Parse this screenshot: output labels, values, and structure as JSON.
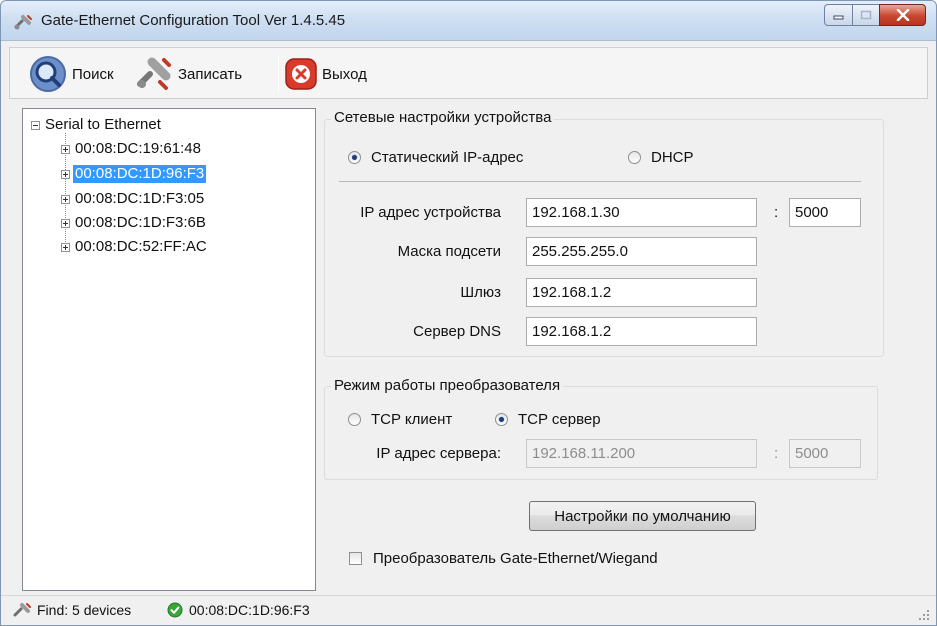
{
  "window": {
    "title": "Gate-Ethernet Configuration Tool Ver 1.4.5.45"
  },
  "toolbar": {
    "search_label": "Поиск",
    "write_label": "Записать",
    "exit_label": "Выход"
  },
  "tree": {
    "root_label": "Serial to Ethernet",
    "devices": [
      {
        "mac": "00:08:DC:19:61:48",
        "selected": false
      },
      {
        "mac": "00:08:DC:1D:96:F3",
        "selected": true
      },
      {
        "mac": "00:08:DC:1D:F3:05",
        "selected": false
      },
      {
        "mac": "00:08:DC:1D:F3:6B",
        "selected": false
      },
      {
        "mac": "00:08:DC:52:FF:AC",
        "selected": false
      }
    ]
  },
  "network": {
    "group_title": "Сетевые настройки устройства",
    "static_ip_label": "Статический IP-адрес",
    "static_ip_selected": true,
    "dhcp_label": "DHCP",
    "dhcp_selected": false,
    "ip_label": "IP адрес устройства",
    "ip_value": "192.168.1.30",
    "port_separator": ":",
    "port_value": "5000",
    "mask_label": "Маска подсети",
    "mask_value": "255.255.255.0",
    "gateway_label": "Шлюз",
    "gateway_value": "192.168.1.2",
    "dns_label": "Сервер DNS",
    "dns_value": "192.168.1.2"
  },
  "mode": {
    "group_title": "Режим работы преобразователя",
    "tcp_client_label": "TCP клиент",
    "tcp_client_selected": false,
    "tcp_server_label": "TCP сервер",
    "tcp_server_selected": true,
    "server_ip_label": "IP адрес сервера:",
    "server_ip_value": "192.168.11.200",
    "port_separator": ":",
    "server_port_value": "5000"
  },
  "defaults_button_label": "Настройки по умолчанию",
  "wiegand_checkbox": {
    "label": "Преобразователь Gate-Ethernet/Wiegand",
    "checked": false
  },
  "status": {
    "find_text": "Find: 5 devices",
    "selected_mac": "00:08:DC:1D:96:F3"
  },
  "colors": {
    "selection": "#3399ff",
    "titlebar": "#cfdff2",
    "status_ok": "#3aa63a",
    "exit_red": "#d93a2b"
  }
}
